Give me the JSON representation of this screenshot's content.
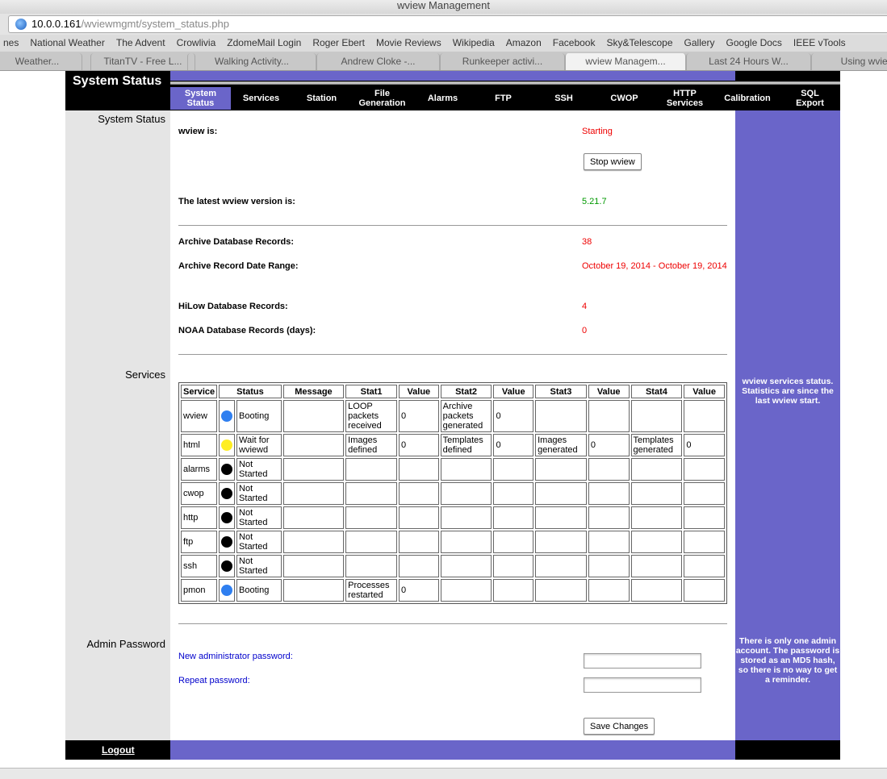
{
  "window": {
    "title": "wview Management"
  },
  "browser": {
    "url_host": "10.0.0.161",
    "url_path": "/wviewmgmt/system_status.php",
    "bookmarks": [
      "nes",
      "National Weather",
      "The Advent",
      "Crowlivia",
      "ZdomeMail Login",
      "Roger Ebert",
      "Movie Reviews",
      "Wikipedia",
      "Amazon",
      "Facebook",
      "Sky&Telescope",
      "Gallery",
      "Google Docs",
      "IEEE vTools"
    ],
    "tabs": [
      "Weather...",
      "TitanTV - Free L...",
      "Walking Activity...",
      "Andrew Cloke -...",
      "Runkeeper activi...",
      "wview Managem...",
      "Last 24 Hours W...",
      "Using wview"
    ]
  },
  "header": {
    "title": "System Status",
    "nav": [
      [
        "System",
        "Status"
      ],
      [
        "Services",
        ""
      ],
      [
        "Station",
        ""
      ],
      [
        "File",
        "Generation"
      ],
      [
        "Alarms",
        ""
      ],
      [
        "FTP",
        ""
      ],
      [
        "SSH",
        ""
      ],
      [
        "CWOP",
        ""
      ],
      [
        "HTTP",
        "Services"
      ],
      [
        "Calibration",
        ""
      ],
      [
        "SQL",
        "Export"
      ]
    ]
  },
  "sections": {
    "system_status": "System Status",
    "services": "Services",
    "admin": "Admin Password"
  },
  "status": {
    "wview_is_label": "wview is:",
    "wview_is": "Starting",
    "stop_button": "Stop wview",
    "version_label": "The latest wview version is:",
    "version": "5.21.7",
    "archive_records_label": "Archive Database Records:",
    "archive_records": "38",
    "date_range_label": "Archive Record Date Range:",
    "date_range": "October 19, 2014 - October 19, 2014",
    "hilow_label": "HiLow Database Records:",
    "hilow": "4",
    "noaa_label": "NOAA Database Records (days):",
    "noaa": "0"
  },
  "services_note": "wview services status. Statistics are since the last wview start.",
  "services_table": {
    "headers": [
      "Service",
      "Status",
      "Message",
      "Stat1",
      "Value",
      "Stat2",
      "Value",
      "Stat3",
      "Value",
      "Stat4",
      "Value"
    ],
    "colors": {
      "blue": "#2f7ff0",
      "yellow": "#ffee22",
      "black": "#000000"
    },
    "rows": [
      {
        "service": "wview",
        "dot": "blue",
        "status": "Booting",
        "message": "",
        "stats": [
          "LOOP packets received",
          "0",
          "Archive packets generated",
          "0",
          "",
          "",
          "",
          ""
        ]
      },
      {
        "service": "html",
        "dot": "yellow",
        "status": "Wait for wviewd",
        "message": "",
        "stats": [
          "Images defined",
          "0",
          "Templates defined",
          "0",
          "Images generated",
          "0",
          "Templates generated",
          "0"
        ]
      },
      {
        "service": "alarms",
        "dot": "black",
        "status": "Not Started",
        "message": "",
        "stats": [
          "",
          "",
          "",
          "",
          "",
          "",
          "",
          ""
        ]
      },
      {
        "service": "cwop",
        "dot": "black",
        "status": "Not Started",
        "message": "",
        "stats": [
          "",
          "",
          "",
          "",
          "",
          "",
          "",
          ""
        ]
      },
      {
        "service": "http",
        "dot": "black",
        "status": "Not Started",
        "message": "",
        "stats": [
          "",
          "",
          "",
          "",
          "",
          "",
          "",
          ""
        ]
      },
      {
        "service": "ftp",
        "dot": "black",
        "status": "Not Started",
        "message": "",
        "stats": [
          "",
          "",
          "",
          "",
          "",
          "",
          "",
          ""
        ]
      },
      {
        "service": "ssh",
        "dot": "black",
        "status": "Not Started",
        "message": "",
        "stats": [
          "",
          "",
          "",
          "",
          "",
          "",
          "",
          ""
        ]
      },
      {
        "service": "pmon",
        "dot": "blue",
        "status": "Booting",
        "message": "",
        "stats": [
          "Processes restarted",
          "0",
          "",
          "",
          "",
          "",
          "",
          ""
        ]
      }
    ]
  },
  "admin": {
    "new_label": "New administrator password:",
    "new_value": "",
    "repeat_label": "Repeat password:",
    "repeat_value": "",
    "save_button": "Save Changes",
    "note": "There is only one admin account. The password is stored as an MD5 hash, so there is no way to get a reminder."
  },
  "footer": {
    "logout": "Logout"
  },
  "colors": {
    "accent": "#6a65c9",
    "sidebar": "#e5e5e5",
    "header": "#000000"
  }
}
